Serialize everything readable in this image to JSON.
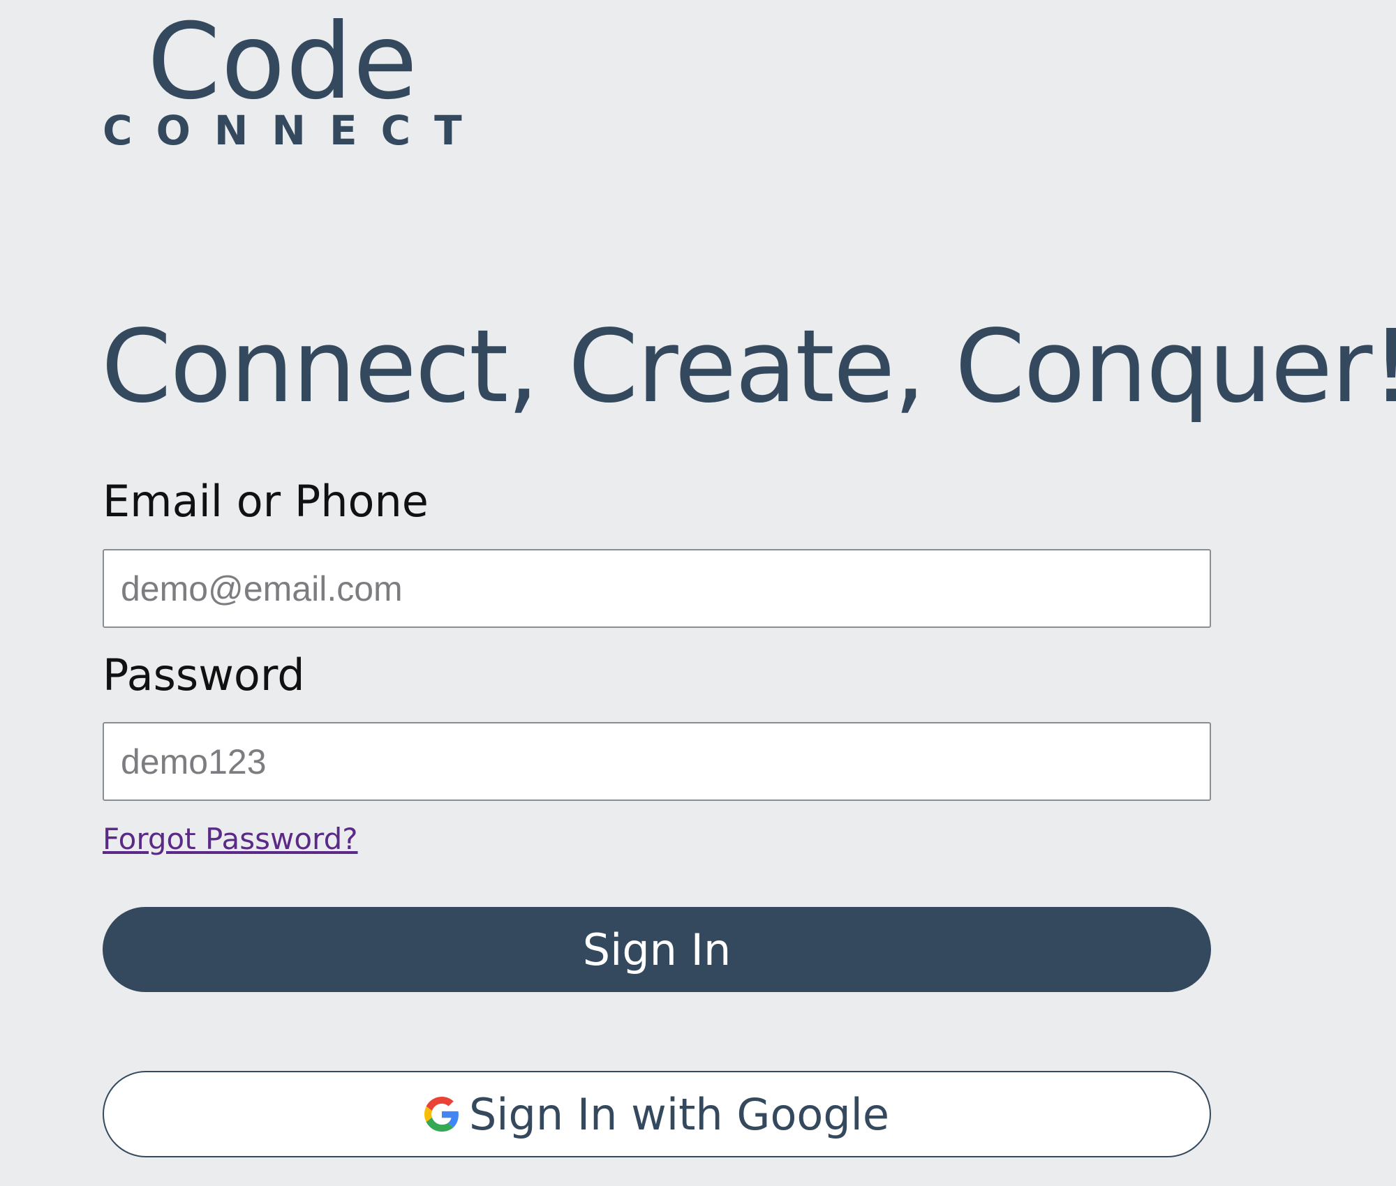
{
  "logo": {
    "line1": "Code",
    "line2": "CONNECT"
  },
  "headline": "Connect, Create, Conquer!",
  "form": {
    "email_label": "Email or Phone",
    "email_placeholder": "demo@email.com",
    "password_label": "Password",
    "password_placeholder": "demo123",
    "forgot_password": "Forgot Password?",
    "sign_in_label": "Sign In",
    "google_sign_in_label": "Sign In with Google"
  },
  "icons": {
    "google": "google-icon"
  },
  "colors": {
    "background": "#ebecee",
    "brand": "#34495e",
    "link": "#5b2a86"
  }
}
